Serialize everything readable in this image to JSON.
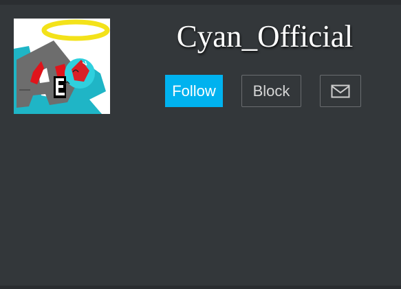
{
  "profile": {
    "username": "Cyan_Official",
    "avatar_icon": "avatar-image"
  },
  "actions": {
    "follow_label": "Follow",
    "block_label": "Block",
    "message_icon": "envelope-icon"
  },
  "colors": {
    "background": "#33373a",
    "follow_button": "#00b2ef",
    "button_border": "#6b6e71",
    "text": "#ffffff"
  }
}
